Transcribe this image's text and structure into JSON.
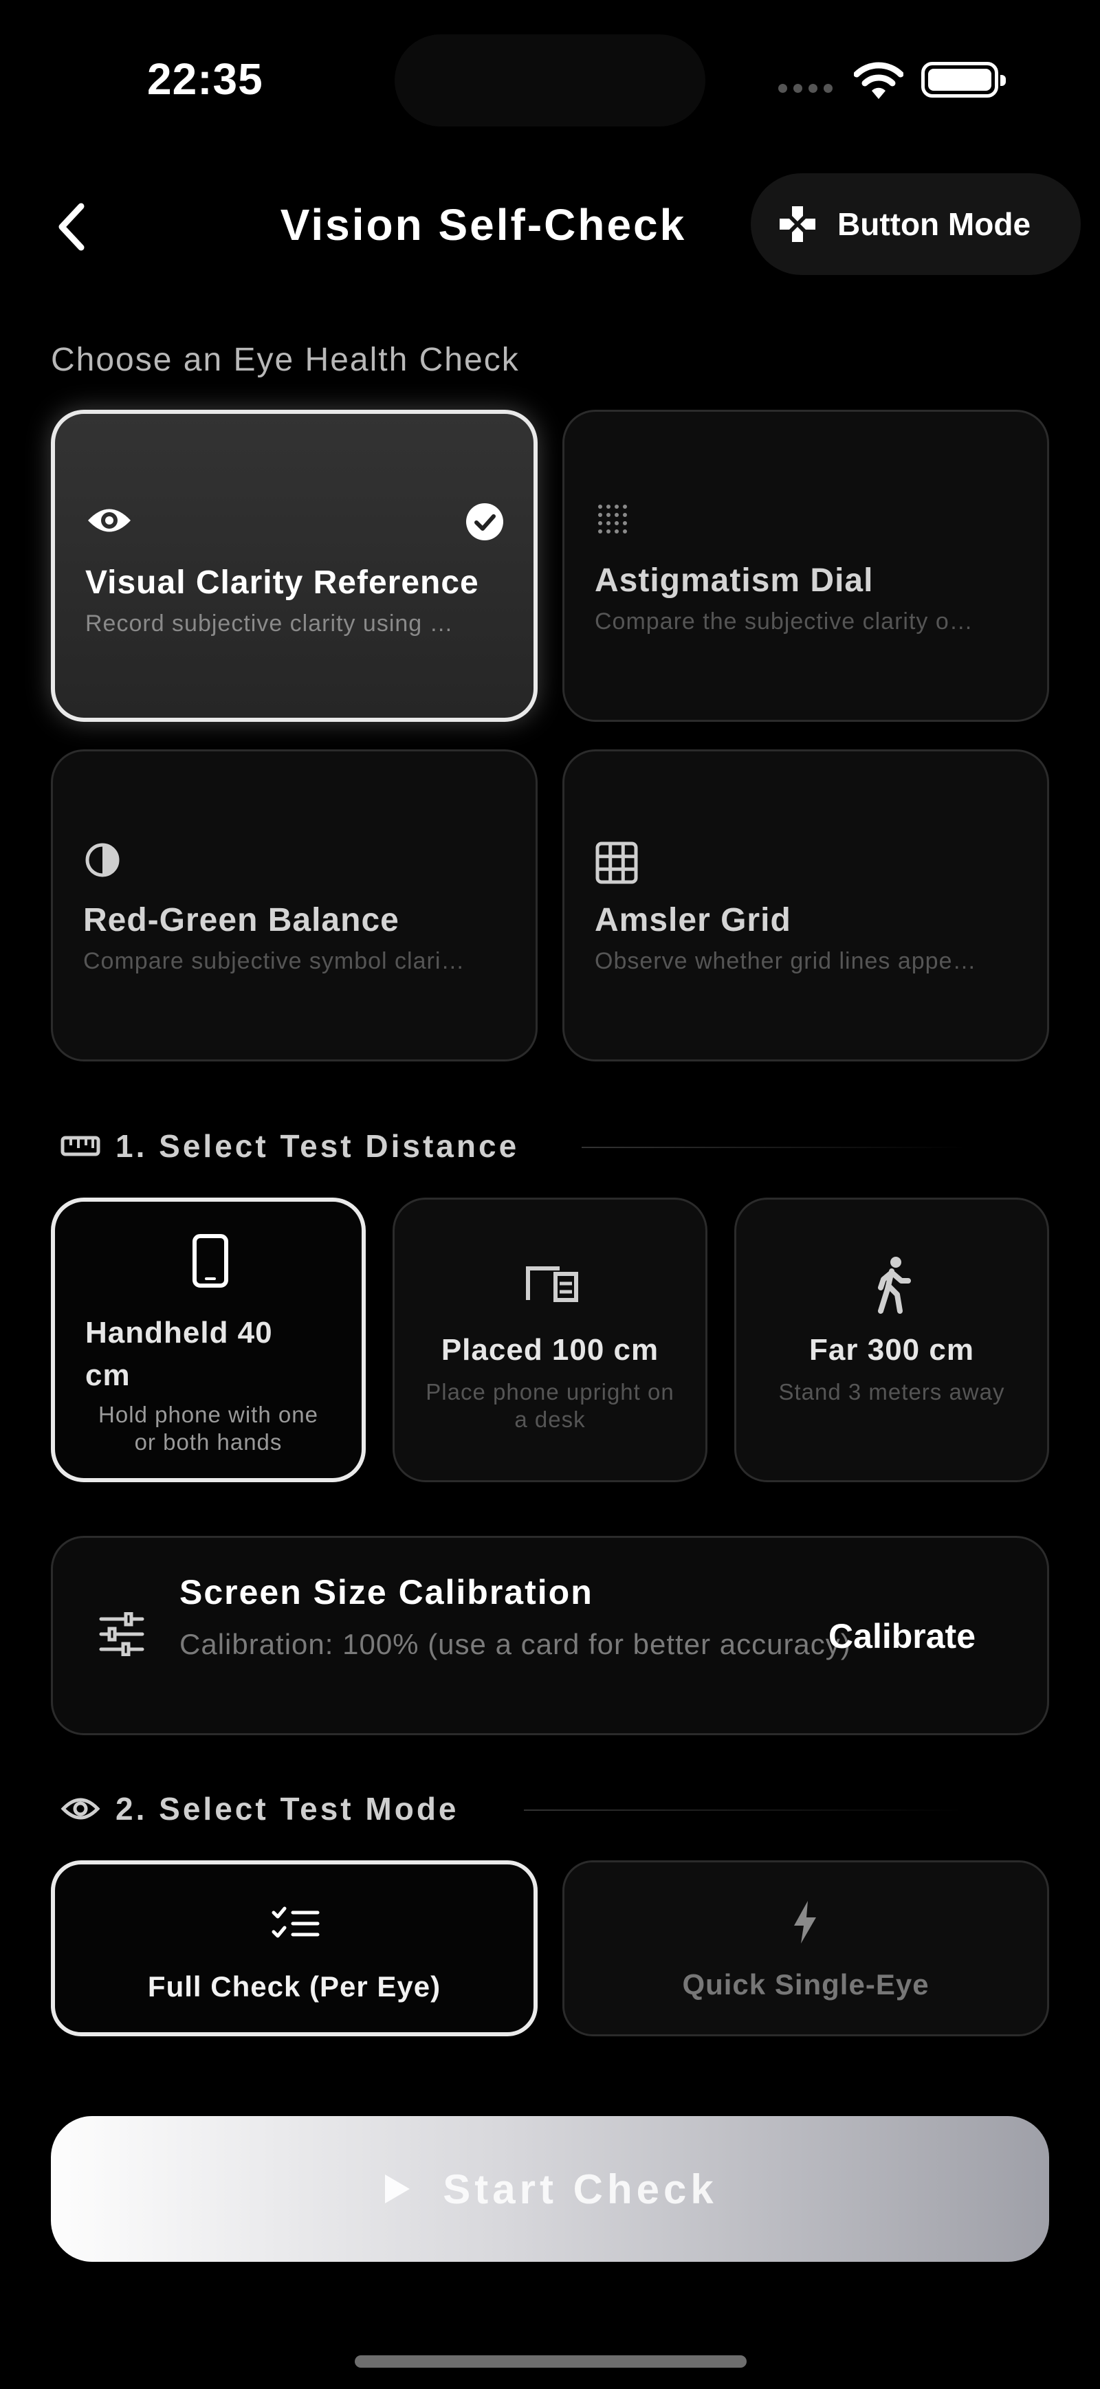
{
  "status_bar": {
    "time": "22:35"
  },
  "nav": {
    "title": "Vision Self-Check",
    "button_mode_label": "Button Mode"
  },
  "check_section": {
    "label": "Choose an Eye Health Check",
    "cards": [
      {
        "title": "Visual Clarity Reference",
        "desc": "Record subjective clarity using …",
        "icon": "eye-icon",
        "selected": true
      },
      {
        "title": "Astigmatism Dial",
        "desc": "Compare the subjective clarity o…",
        "icon": "dot-grid-icon",
        "selected": false
      },
      {
        "title": "Red-Green Balance",
        "desc": "Compare subjective symbol clari…",
        "icon": "contrast-icon",
        "selected": false
      },
      {
        "title": "Amsler Grid",
        "desc": "Observe whether grid lines appe…",
        "icon": "grid-icon",
        "selected": false
      }
    ]
  },
  "distance_section": {
    "label": "1. Select Test Distance",
    "options": [
      {
        "title": "Handheld 40 cm",
        "desc": "Hold phone with one or both hands",
        "icon": "phone-icon",
        "selected": true
      },
      {
        "title": "Placed 100 cm",
        "desc": "Place phone upright on a desk",
        "icon": "desk-icon",
        "selected": false
      },
      {
        "title": "Far 300 cm",
        "desc": "Stand 3 meters away",
        "icon": "walking-person-icon",
        "selected": false
      }
    ]
  },
  "calibration": {
    "title": "Screen Size Calibration",
    "subtitle": "Calibration: 100% (use a card for better accuracy)",
    "action": "Calibrate"
  },
  "mode_section": {
    "label": "2. Select Test Mode",
    "options": [
      {
        "label": "Full Check (Per Eye)",
        "icon": "checklist-icon",
        "selected": true
      },
      {
        "label": "Quick Single-Eye",
        "icon": "lightning-icon",
        "selected": false
      }
    ]
  },
  "start_button": {
    "label": "Start Check"
  }
}
